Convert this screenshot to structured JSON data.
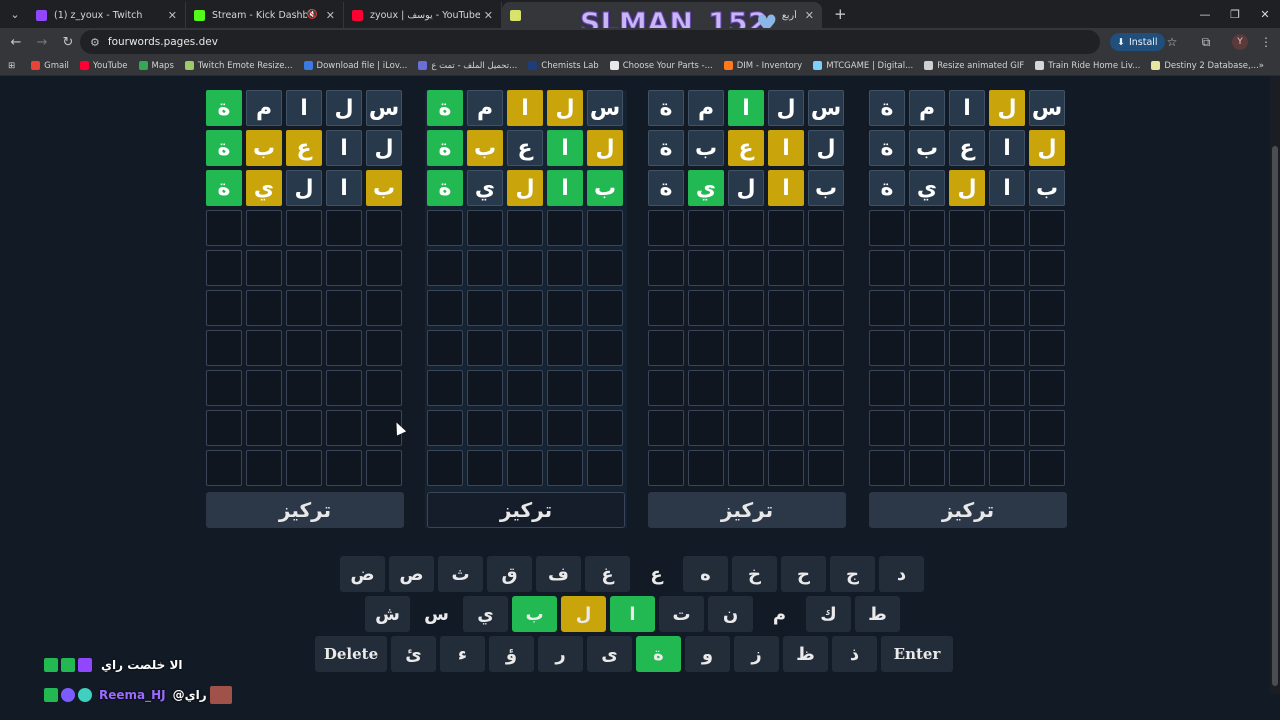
{
  "tabs": [
    {
      "title": "(1) z_youx - Twitch",
      "fav": "#9146ff"
    },
    {
      "title": "Stream - Kick Dashboard",
      "fav": "#53fc18"
    },
    {
      "title": "zyoux | يوسف - YouTube",
      "fav": "#ff0033"
    },
    {
      "title": "أربع",
      "fav": "#d9e36b"
    }
  ],
  "watermark": "SLMAN_152",
  "url": "fourwords.pages.dev",
  "install_label": "Install",
  "profile_letter": "Y",
  "bookmarks": [
    {
      "label": "Gmail",
      "color": "#ea4335"
    },
    {
      "label": "YouTube",
      "color": "#ff0033"
    },
    {
      "label": "Maps",
      "color": "#34a853"
    },
    {
      "label": "Twitch Emote Resize...",
      "color": "#9ccc65"
    },
    {
      "label": "Download file | iLov...",
      "color": "#3b7ae0"
    },
    {
      "label": "تحميل الملف - تمت ع...",
      "color": "#6a6fd6"
    },
    {
      "label": "Chemists Lab",
      "color": "#1d3e7a"
    },
    {
      "label": "Choose Your Parts -...",
      "color": "#e8e8e8"
    },
    {
      "label": "DIM - Inventory",
      "color": "#ff7a1a"
    },
    {
      "label": "MTCGAME | Digital...",
      "color": "#7ad0ff"
    },
    {
      "label": "Resize animated GIF",
      "color": "#cfcfcf"
    },
    {
      "label": "Train Ride Home Liv...",
      "color": "#d6d6d6"
    },
    {
      "label": "Destiny 2 Database,...",
      "color": "#e6e6a0"
    }
  ],
  "boards": [
    {
      "focused": false,
      "rows": [
        [
          [
            "س",
            "n"
          ],
          [
            "ل",
            "n"
          ],
          [
            "ا",
            "n"
          ],
          [
            "م",
            "n"
          ],
          [
            "ة",
            "g"
          ]
        ],
        [
          [
            "ل",
            "n"
          ],
          [
            "ا",
            "n"
          ],
          [
            "ع",
            "y"
          ],
          [
            "ب",
            "y"
          ],
          [
            "ة",
            "g"
          ]
        ],
        [
          [
            "ب",
            "y"
          ],
          [
            "ا",
            "n"
          ],
          [
            "ل",
            "n"
          ],
          [
            "ي",
            "y"
          ],
          [
            "ة",
            "g"
          ]
        ]
      ],
      "focus_label": "تركيز"
    },
    {
      "focused": true,
      "rows": [
        [
          [
            "س",
            "n"
          ],
          [
            "ل",
            "y"
          ],
          [
            "ا",
            "y"
          ],
          [
            "م",
            "n"
          ],
          [
            "ة",
            "g"
          ]
        ],
        [
          [
            "ل",
            "y"
          ],
          [
            "ا",
            "g"
          ],
          [
            "ع",
            "n"
          ],
          [
            "ب",
            "y"
          ],
          [
            "ة",
            "g"
          ]
        ],
        [
          [
            "ب",
            "g"
          ],
          [
            "ا",
            "g"
          ],
          [
            "ل",
            "y"
          ],
          [
            "ي",
            "n"
          ],
          [
            "ة",
            "g"
          ]
        ]
      ],
      "focus_label": "تركيز"
    },
    {
      "focused": false,
      "rows": [
        [
          [
            "س",
            "n"
          ],
          [
            "ل",
            "n"
          ],
          [
            "ا",
            "g"
          ],
          [
            "م",
            "n"
          ],
          [
            "ة",
            "n"
          ]
        ],
        [
          [
            "ل",
            "n"
          ],
          [
            "ا",
            "y"
          ],
          [
            "ع",
            "y"
          ],
          [
            "ب",
            "n"
          ],
          [
            "ة",
            "n"
          ]
        ],
        [
          [
            "ب",
            "n"
          ],
          [
            "ا",
            "y"
          ],
          [
            "ل",
            "n"
          ],
          [
            "ي",
            "g"
          ],
          [
            "ة",
            "n"
          ]
        ]
      ],
      "focus_label": "تركيز"
    },
    {
      "focused": false,
      "rows": [
        [
          [
            "س",
            "n"
          ],
          [
            "ل",
            "y"
          ],
          [
            "ا",
            "n"
          ],
          [
            "م",
            "n"
          ],
          [
            "ة",
            "n"
          ]
        ],
        [
          [
            "ل",
            "y"
          ],
          [
            "ا",
            "n"
          ],
          [
            "ع",
            "n"
          ],
          [
            "ب",
            "n"
          ],
          [
            "ة",
            "n"
          ]
        ],
        [
          [
            "ب",
            "n"
          ],
          [
            "ا",
            "n"
          ],
          [
            "ل",
            "y"
          ],
          [
            "ي",
            "n"
          ],
          [
            "ة",
            "n"
          ]
        ]
      ],
      "focus_label": "تركيز"
    }
  ],
  "keyboard": {
    "row1": [
      [
        "ض",
        "n"
      ],
      [
        "ص",
        "n"
      ],
      [
        "ث",
        "n"
      ],
      [
        "ق",
        "n"
      ],
      [
        "ف",
        "n"
      ],
      [
        "غ",
        "n"
      ],
      [
        "ع",
        "x"
      ],
      [
        "ه",
        "n"
      ],
      [
        "خ",
        "n"
      ],
      [
        "ح",
        "n"
      ],
      [
        "ج",
        "n"
      ],
      [
        "د",
        "n"
      ]
    ],
    "row2": [
      [
        "ش",
        "n"
      ],
      [
        "س",
        "x"
      ],
      [
        "ي",
        "n"
      ],
      [
        "ب",
        "g"
      ],
      [
        "ل",
        "y"
      ],
      [
        "ا",
        "g"
      ],
      [
        "ت",
        "n"
      ],
      [
        "ن",
        "n"
      ],
      [
        "م",
        "x"
      ],
      [
        "ك",
        "n"
      ],
      [
        "ط",
        "n"
      ]
    ],
    "row3": [
      [
        "Delete",
        "w"
      ],
      [
        "ئ",
        "n"
      ],
      [
        "ء",
        "n"
      ],
      [
        "ؤ",
        "n"
      ],
      [
        "ر",
        "n"
      ],
      [
        "ى",
        "n"
      ],
      [
        "ة",
        "g"
      ],
      [
        "و",
        "n"
      ],
      [
        "ز",
        "n"
      ],
      [
        "ظ",
        "n"
      ],
      [
        "ذ",
        "n"
      ],
      [
        "Enter",
        "w"
      ]
    ]
  },
  "chat": [
    {
      "user": "",
      "text": "الا خلصت راي"
    },
    {
      "user": "Reema_HJ",
      "text": "@راي"
    }
  ]
}
